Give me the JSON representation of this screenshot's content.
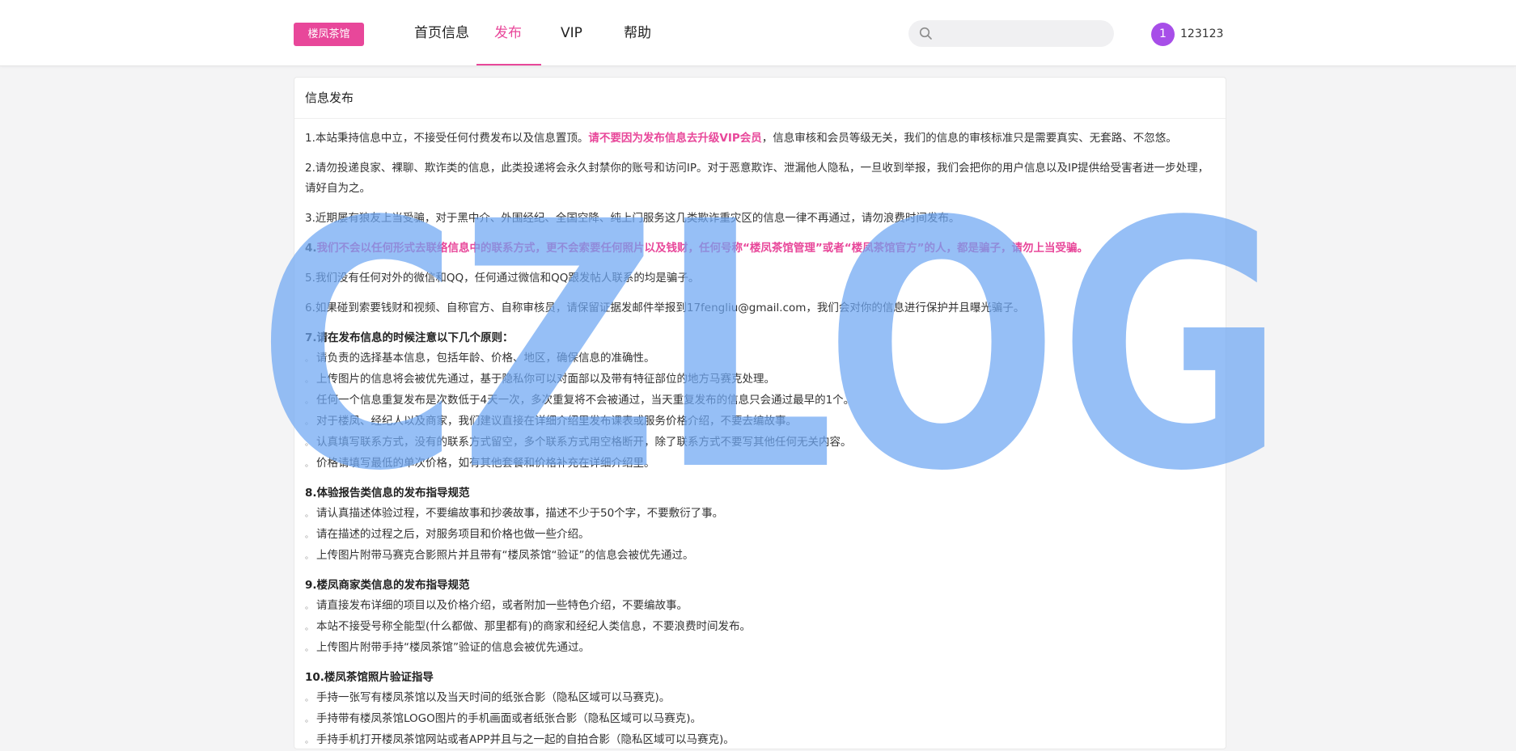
{
  "header": {
    "logo": "楼凤茶馆",
    "nav": [
      {
        "label": "首页信息",
        "active": false
      },
      {
        "label": "发布",
        "active": true
      },
      {
        "label": "VIP",
        "active": false
      },
      {
        "label": "帮助",
        "active": false
      }
    ],
    "search": {
      "value": "",
      "placeholder": ""
    },
    "avatar_initial": "1",
    "username": "123123"
  },
  "panel": {
    "title": "信息发布",
    "p1_a": "1.本站秉持信息中立，不接受任何付费发布以及信息置顶。",
    "p1_b": "请不要因为发布信息去升级VIP会员",
    "p1_c": "，信息审核和会员等级无关，我们的信息的审核标准只是需要真实、无套路、不忽悠。",
    "p2": "2.请勿投递良家、裸聊、欺诈类的信息，此类投递将会永久封禁你的账号和访问IP。对于恶意欺诈、泄漏他人隐私，一旦收到举报，我们会把你的用户信息以及IP提供给受害者进一步处理，请好自为之。",
    "p3": "3.近期屡有狼友上当受骗，对于黑中介、外围经纪、全国空降、纯上门服务这几类欺诈重灾区的信息一律不再通过，请勿浪费时间发布。",
    "p4_a": "4.",
    "p4_b": "我们不会以任何形式去联络信息中的联系方式，更不会索要任何照片以及钱财，任何号称“楼凤茶馆管理”或者“楼凤茶馆官方”的人，都是骗子，请勿上当受骗。",
    "p5": "5.我们没有任何对外的微信和QQ，任何通过微信和QQ跟发帖人联系的均是骗子。",
    "p6": "6.如果碰到索要钱财和视频、自称官方、自称审核员，请保留证据发邮件举报到17fengliu@gmail.com，我们会对你的信息进行保护并且曝光骗子。",
    "s7_title": "7.请在发布信息的时候注意以下几个原则：",
    "s7_items": [
      "请负责的选择基本信息，包括年龄、价格、地区，确保信息的准确性。",
      "上传图片的信息将会被优先通过，基于隐私你可以对面部以及带有特征部位的地方马赛克处理。",
      "任何一个信息重复发布是次数低于4天一次，多次重复将不会被通过，当天重复发布的信息只会通过最早的1个。",
      "对于楼凤、经纪人以及商家，我们建议直接在详细介绍里发布课表或服务价格介绍，不要去编故事。",
      "认真填写联系方式，没有的联系方式留空，多个联系方式用空格断开，除了联系方式不要写其他任何无关内容。",
      "价格请填写最低的单次价格，如有其他套餐和价格补充在详细介绍里。"
    ],
    "s8_title": "8.体验报告类信息的发布指导规范",
    "s8_items": [
      "请认真描述体验过程，不要编故事和抄袭故事，描述不少于50个字，不要敷衍了事。",
      "请在描述的过程之后，对服务项目和价格也做一些介绍。",
      "上传图片附带马赛克合影照片并且带有“楼凤茶馆“验证”的信息会被优先通过。"
    ],
    "s9_title": "9.楼凤商家类信息的发布指导规范",
    "s9_items": [
      "请直接发布详细的项目以及价格介绍，或者附加一些特色介绍，不要编故事。",
      "本站不接受号称全能型(什么都做、那里都有)的商家和经纪人类信息，不要浪费时间发布。",
      "上传图片附带手持“楼凤茶馆”验证的信息会被优先通过。"
    ],
    "s10_title": "10.楼凤茶馆照片验证指导",
    "s10_items": [
      "手持一张写有楼凤茶馆以及当天时间的纸张合影（隐私区域可以马赛克)。",
      "手持带有楼凤茶馆LOGO图片的手机画面或者纸张合影（隐私区域可以马赛克)。",
      "手持手机打开楼凤茶馆网站或者APP并且与之一起的自拍合影（隐私区域可以马赛克)。"
    ]
  },
  "watermark": {
    "text": "CZLOG",
    "color": "#6ea6f2"
  },
  "colors": {
    "accent": "#e8479a",
    "avatar": "#a74ee8"
  }
}
